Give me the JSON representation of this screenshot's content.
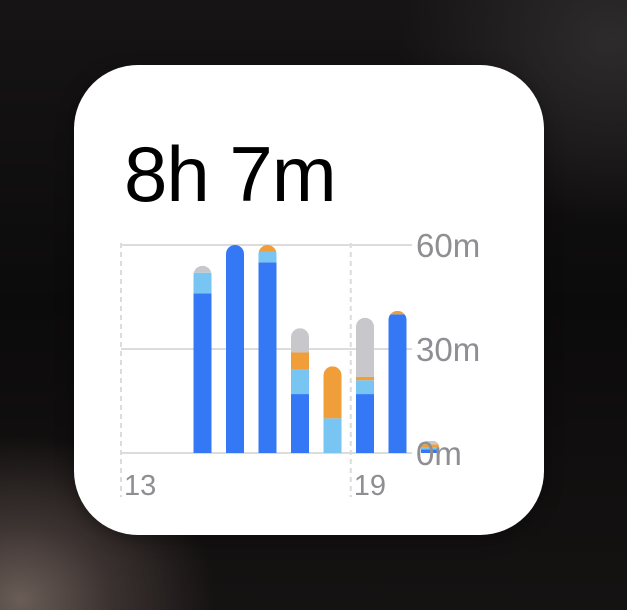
{
  "widget": {
    "total_time": "8h 7m"
  },
  "colors": {
    "blue": "#3478f6",
    "light_blue": "#78c4f2",
    "orange": "#f09e3a",
    "gray": "#c8c8cc",
    "grid": "#dcdcdc",
    "label": "#8e8e93"
  },
  "chart_data": {
    "type": "bar",
    "stacked": true,
    "ylim": [
      0,
      60
    ],
    "y_ticks": [
      "60m",
      "30m",
      "0m"
    ],
    "y_tick_values": [
      60,
      30,
      0
    ],
    "x_tick_labels": [
      "13",
      "19"
    ],
    "x_tick_indices": [
      0,
      6
    ],
    "categories": [
      "13",
      "14",
      "15",
      "16",
      "17",
      "18",
      "19",
      "20",
      "21"
    ],
    "series": [
      {
        "color_key": "blue",
        "values": [
          0,
          46,
          60,
          55,
          17,
          0,
          17,
          40,
          1
        ]
      },
      {
        "color_key": "light_blue",
        "values": [
          0,
          6,
          0,
          3,
          7,
          10,
          4,
          0,
          0.5
        ]
      },
      {
        "color_key": "orange",
        "values": [
          0,
          0,
          0,
          2,
          5,
          15,
          1,
          1,
          1
        ]
      },
      {
        "color_key": "gray",
        "values": [
          0,
          2,
          0,
          0,
          7,
          0,
          17,
          0,
          1
        ]
      }
    ]
  }
}
